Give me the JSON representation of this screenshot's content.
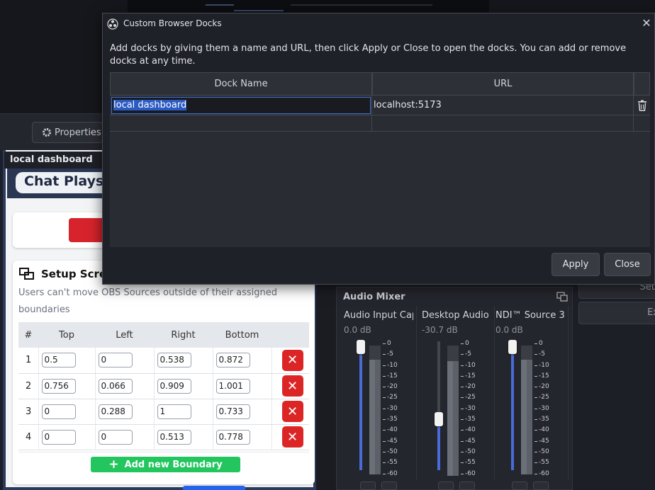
{
  "properties_button": "Properties",
  "dock": {
    "title": "local dashboard",
    "header_title": "Chat Plays"
  },
  "setup": {
    "title": "Setup Scre",
    "description": "Users can't move OBS Sources outside of their assigned boundaries",
    "columns": [
      "#",
      "Top",
      "Left",
      "Right",
      "Bottom"
    ],
    "rows": [
      {
        "num": "1",
        "top": "0.5",
        "left": "0",
        "right": "0.538",
        "bottom": "0.872"
      },
      {
        "num": "2",
        "top": "0.756",
        "left": "0.066",
        "right": "0.909",
        "bottom": "1.001"
      },
      {
        "num": "3",
        "top": "0",
        "left": "0.288",
        "right": "1",
        "bottom": "0.733"
      },
      {
        "num": "4",
        "top": "0",
        "left": "0",
        "right": "0.513",
        "bottom": "0.778"
      }
    ],
    "delete_symbol": "✕",
    "add_label": "Add new Boundary",
    "add_icon": "+"
  },
  "mixer": {
    "title": "Audio Mixer",
    "scale": [
      "0",
      "-5",
      "-10",
      "-15",
      "-20",
      "-25",
      "-30",
      "-35",
      "-40",
      "-45",
      "-50",
      "-55",
      "-60"
    ],
    "channels": [
      {
        "name": "Audio Input Capt",
        "db": "0.0 dB",
        "level": 1.0
      },
      {
        "name": "Desktop Audio",
        "db": "-30.7 dB",
        "level": 0.44
      },
      {
        "name": "NDI™ Source 3",
        "db": "0.0 dB",
        "level": 1.0
      }
    ]
  },
  "right_buttons": [
    "Sett",
    "Ex"
  ],
  "dialog": {
    "title": "Custom Browser Docks",
    "description": "Add docks by giving them a name and URL, then click Apply or Close to open the docks. You can add or remove docks at any time.",
    "col_name": "Dock Name",
    "col_url": "URL",
    "row_name": "local dashboard",
    "row_url": "localhost:5173",
    "apply": "Apply",
    "close": "Close",
    "close_glyph": "✕"
  }
}
